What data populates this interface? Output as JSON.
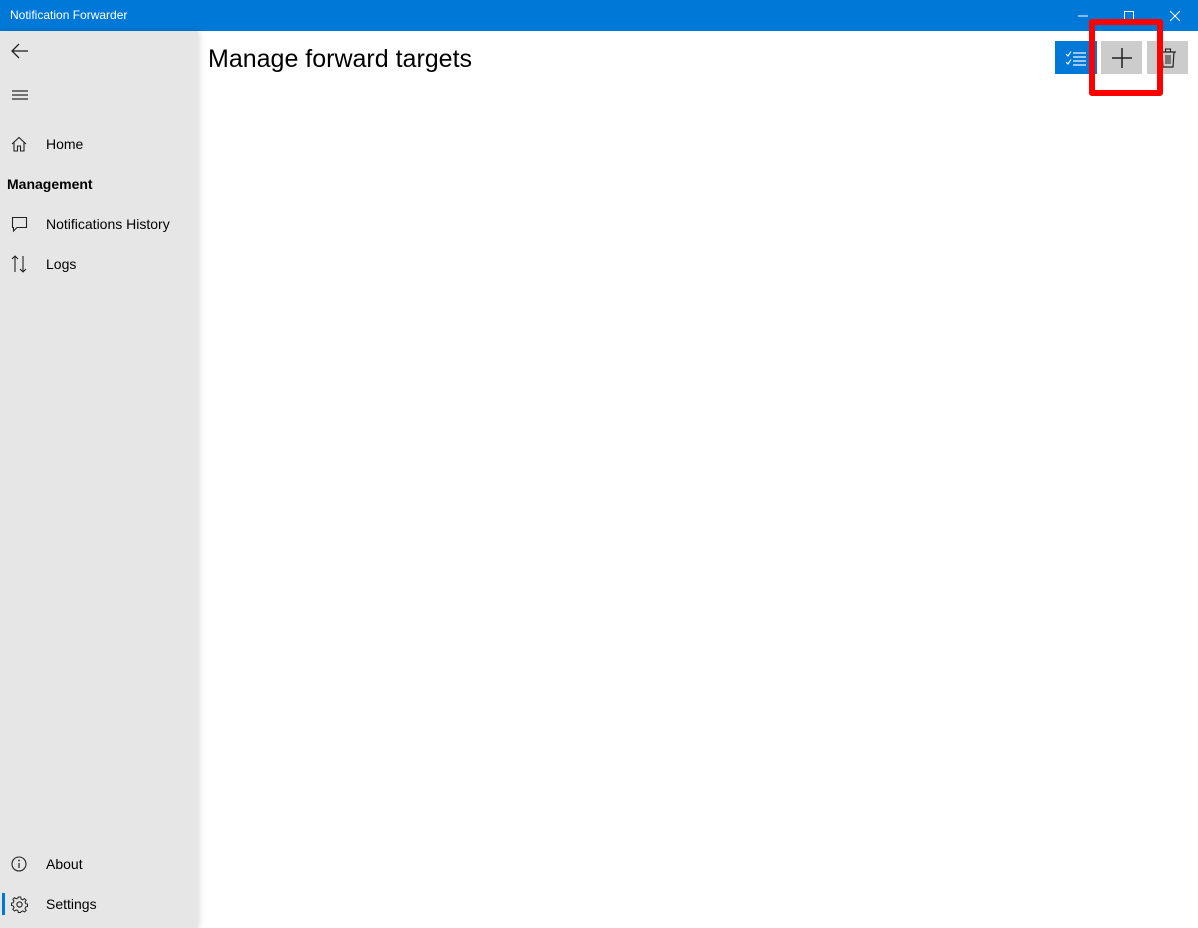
{
  "window": {
    "title": "Notification Forwarder",
    "controls": [
      "minimize",
      "maximize",
      "close"
    ]
  },
  "sidebar": {
    "back_icon": "back-arrow-icon",
    "menu_icon": "hamburger-icon",
    "items": [
      {
        "label": "Home",
        "icon": "home-icon"
      },
      {
        "label": "Notifications History",
        "icon": "speech-bubble-icon"
      },
      {
        "label": "Logs",
        "icon": "up-down-arrows-icon"
      }
    ],
    "section_header": "Management",
    "footer_items": [
      {
        "label": "About",
        "icon": "info-icon"
      },
      {
        "label": "Settings",
        "icon": "gear-icon",
        "selected": true
      }
    ]
  },
  "main": {
    "title": "Manage forward targets",
    "commands": [
      {
        "name": "select",
        "icon": "checklist-icon",
        "accent": true
      },
      {
        "name": "add",
        "icon": "plus-icon",
        "highlighted": true
      },
      {
        "name": "delete",
        "icon": "trash-icon"
      }
    ]
  },
  "colors": {
    "accent": "#0078d7",
    "sidebar_bg": "#e6e6e6",
    "highlight": "#ff0000"
  }
}
